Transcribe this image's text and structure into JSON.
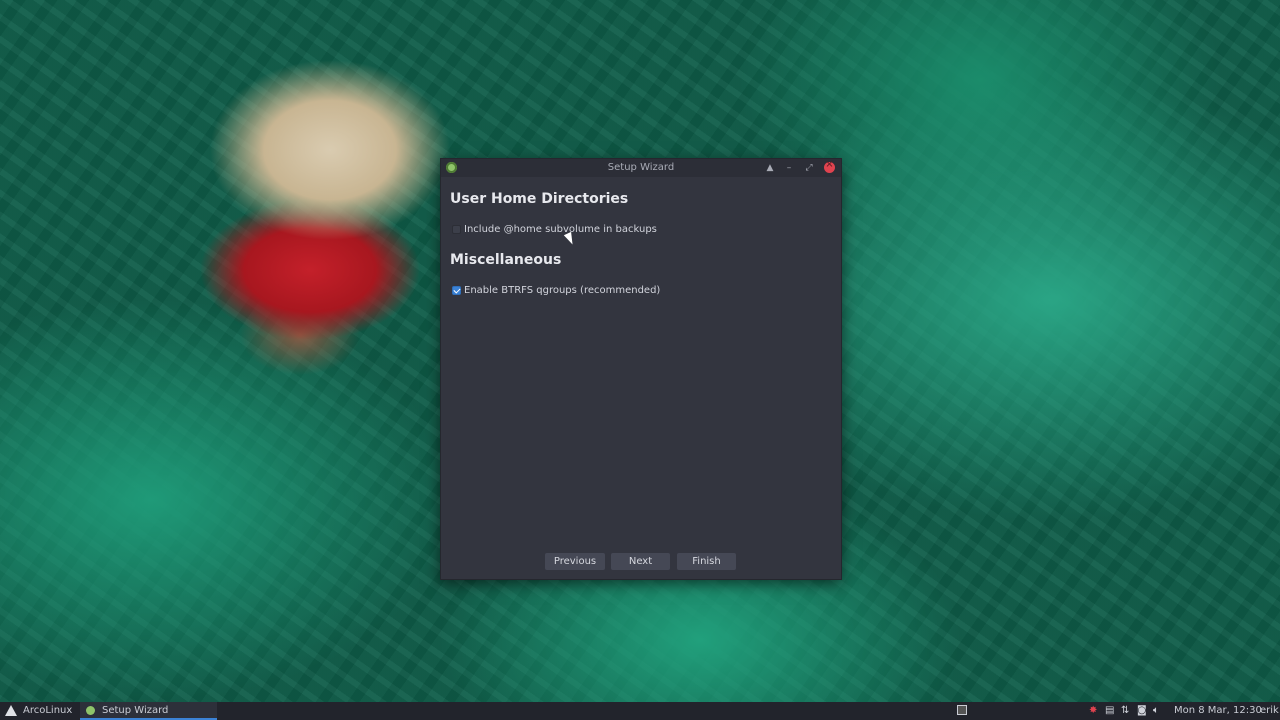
{
  "window": {
    "title": "Setup Wizard",
    "controls": {
      "shade": "▲",
      "minimize": "–",
      "maximize": "⤢"
    }
  },
  "sections": {
    "home": {
      "heading": "User Home Directories",
      "option_label": "Include @home subvolume in backups",
      "option_checked": false
    },
    "misc": {
      "heading": "Miscellaneous",
      "option_label": "Enable BTRFS qgroups (recommended)",
      "option_checked": true
    }
  },
  "buttons": {
    "previous": "Previous",
    "next": "Next",
    "finish": "Finish"
  },
  "taskbar": {
    "menu_label": "ArcoLinux",
    "task_label": "Setup Wizard",
    "clock": "Mon  8 Mar, 12:30",
    "user": "erik"
  },
  "colors": {
    "accent": "#3b82d6",
    "window_bg": "#33353f",
    "close": "#e0434f"
  }
}
